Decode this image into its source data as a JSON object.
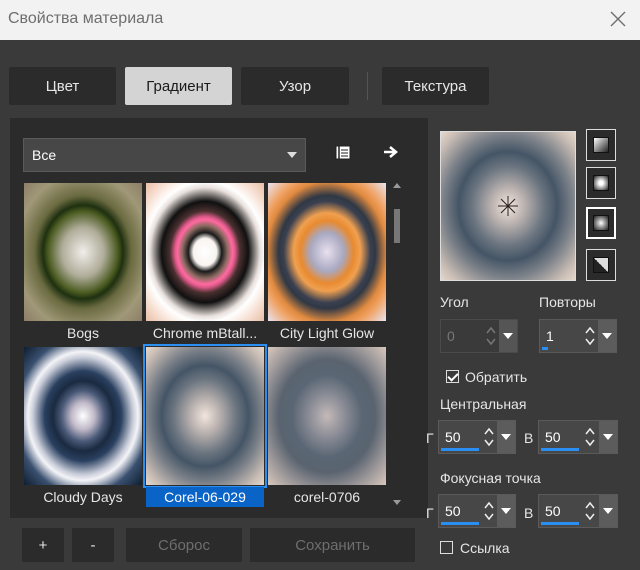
{
  "window": {
    "title": "Свойства материала"
  },
  "tabs": [
    {
      "label": "Цвет",
      "active": false
    },
    {
      "label": "Градиент",
      "active": true
    },
    {
      "label": "Узор",
      "active": false
    },
    {
      "label": "Текстура",
      "active": false
    }
  ],
  "category": {
    "selected": "Все"
  },
  "gradients": [
    {
      "name": "Bogs",
      "selected": false
    },
    {
      "name": "Chrome mBtall...",
      "selected": false
    },
    {
      "name": "City Light Glow",
      "selected": false
    },
    {
      "name": "Cloudy Days",
      "selected": false
    },
    {
      "name": "Corel-06-029",
      "selected": true
    },
    {
      "name": "corel-0706",
      "selected": false
    }
  ],
  "buttons": {
    "add": "+",
    "remove": "-",
    "reset": "Сборос",
    "save": "Сохранить"
  },
  "settings": {
    "angle": {
      "label": "Угол",
      "value": "0",
      "enabled": false
    },
    "repeats": {
      "label": "Повторы",
      "value": "1",
      "level": 0.05
    },
    "invert": {
      "label": "Обратить",
      "checked": true
    },
    "center": {
      "label": "Центральная",
      "h_label": "Г",
      "h": "50",
      "v_label": "В",
      "v": "50"
    },
    "focal": {
      "label": "Фокусная точка",
      "h_label": "Г",
      "h": "50",
      "v_label": "В",
      "v": "50"
    },
    "link": {
      "label": "Ссылка",
      "checked": false
    }
  },
  "colors": {
    "accent": "#2a8ff0",
    "selection": "#0a64c8",
    "panel": "#2b2b2b",
    "background": "#3a3a3a"
  },
  "icons": [
    "close-icon",
    "library-icon",
    "arrow-right-icon",
    "crosshair-icon",
    "linear-gradient-icon",
    "rectangular-gradient-icon",
    "radial-gradient-icon",
    "conical-gradient-icon"
  ]
}
